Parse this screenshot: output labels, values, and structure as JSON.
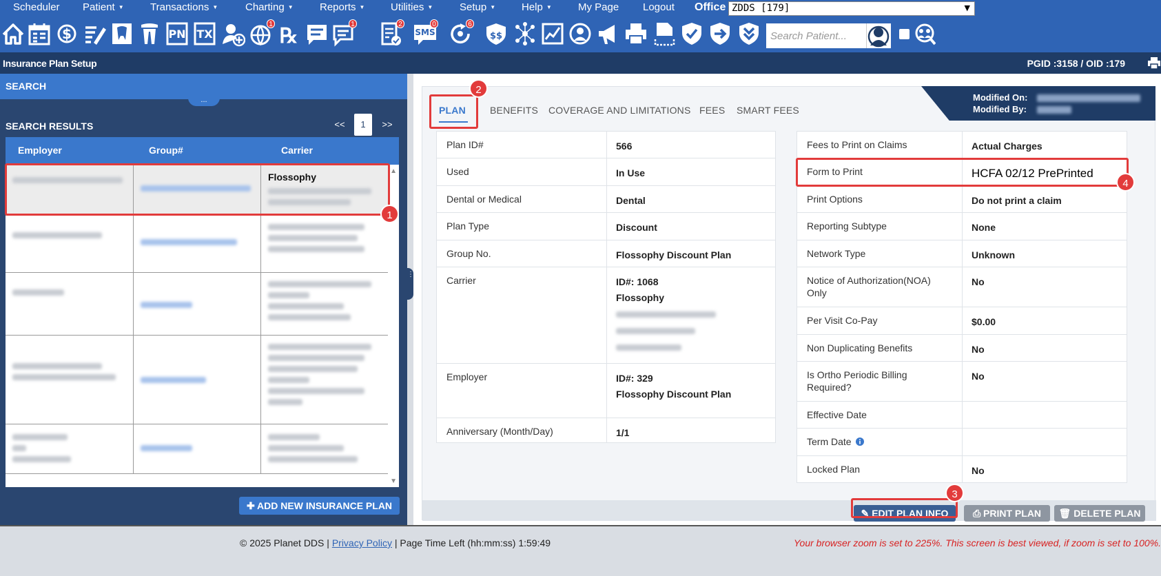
{
  "menu": {
    "items": [
      {
        "label": "Scheduler",
        "caret": false
      },
      {
        "label": "Patient",
        "caret": true
      },
      {
        "label": "Transactions",
        "caret": true
      },
      {
        "label": "Charting",
        "caret": true
      },
      {
        "label": "Reports",
        "caret": true
      },
      {
        "label": "Utilities",
        "caret": true
      },
      {
        "label": "Setup",
        "caret": true
      },
      {
        "label": "Help",
        "caret": true
      },
      {
        "label": "My Page",
        "caret": false
      },
      {
        "label": "Logout",
        "caret": false
      }
    ],
    "office_label": "Office",
    "office_value": "ZDDS [179]"
  },
  "toolbar": {
    "search_placeholder": "Search Patient...",
    "text_icons": {
      "pn": "PN",
      "tx": "TX",
      "sms": "SMS"
    },
    "badges": {
      "globe": "1",
      "chat": "1",
      "checklist": "2",
      "sms": "0",
      "recall": "6"
    }
  },
  "titlebar": {
    "title": "Insurance Plan Setup",
    "ids": "PGID :3158  /  OID :179"
  },
  "search": {
    "header": "SEARCH",
    "collapse_glyph": "...",
    "results_title": "SEARCH RESULTS",
    "pager": {
      "prev": "<<",
      "page": "1",
      "next": ">>"
    },
    "columns": [
      "Employer",
      "Group#",
      "Carrier"
    ],
    "selected_carrier": "Flossophy",
    "add_button": "ADD NEW INSURANCE PLAN"
  },
  "tabs": [
    "PLAN",
    "BENEFITS",
    "COVERAGE AND LIMITATIONS",
    "FEES",
    "SMART FEES"
  ],
  "modified": {
    "on_label": "Modified On:",
    "by_label": "Modified By:"
  },
  "plan_left": [
    {
      "label": "Plan ID#",
      "value": "566"
    },
    {
      "label": "Used",
      "value": "In Use"
    },
    {
      "label": "Dental or Medical",
      "value": "Dental"
    },
    {
      "label": "Plan Type",
      "value": "Discount"
    },
    {
      "label": "Group No.",
      "value": "Flossophy Discount Plan"
    },
    {
      "label": "Carrier",
      "value": "ID#: 1068",
      "value2": "Flossophy"
    },
    {
      "label": "Employer",
      "value": "ID#: 329",
      "value2": "Flossophy Discount Plan"
    },
    {
      "label": "Anniversary (Month/Day)",
      "value": "1/1"
    }
  ],
  "plan_right": [
    {
      "label": "Fees to Print on Claims",
      "value": "Actual Charges"
    },
    {
      "label": "Form to Print",
      "value": "HCFA 02/12 PrePrinted"
    },
    {
      "label": "Print Options",
      "value": "Do not print a claim"
    },
    {
      "label": "Reporting Subtype",
      "value": "None"
    },
    {
      "label": "Network Type",
      "value": "Unknown"
    },
    {
      "label": "Notice of Authorization(NOA) Only",
      "value": "No"
    },
    {
      "label": "Per Visit Co-Pay",
      "value": "$0.00"
    },
    {
      "label": "Non Duplicating Benefits",
      "value": "No"
    },
    {
      "label": "Is Ortho Periodic Billing Required?",
      "value": "No"
    },
    {
      "label": "Effective Date",
      "value": ""
    },
    {
      "label": "Term Date",
      "value": ""
    },
    {
      "label": "Locked Plan",
      "value": "No"
    }
  ],
  "actions": {
    "edit": "EDIT PLAN INFO",
    "print": "PRINT PLAN",
    "delete": "DELETE PLAN"
  },
  "footer": {
    "copyright": "© 2025 Planet DDS |",
    "privacy": "Privacy Policy",
    "time_left": "| Page Time Left (hh:mm:ss) 1:59:49",
    "zoom_warning": "Your browser zoom is set to 225%. This screen is best viewed, if zoom is set to 100%."
  },
  "annotations": [
    "1",
    "2",
    "3",
    "4"
  ],
  "colors": {
    "primary": "#2f64b5",
    "navy": "#1f3c66",
    "accent": "#3a78cc",
    "annotation": "#e23b3b",
    "warning": "#d82222"
  }
}
